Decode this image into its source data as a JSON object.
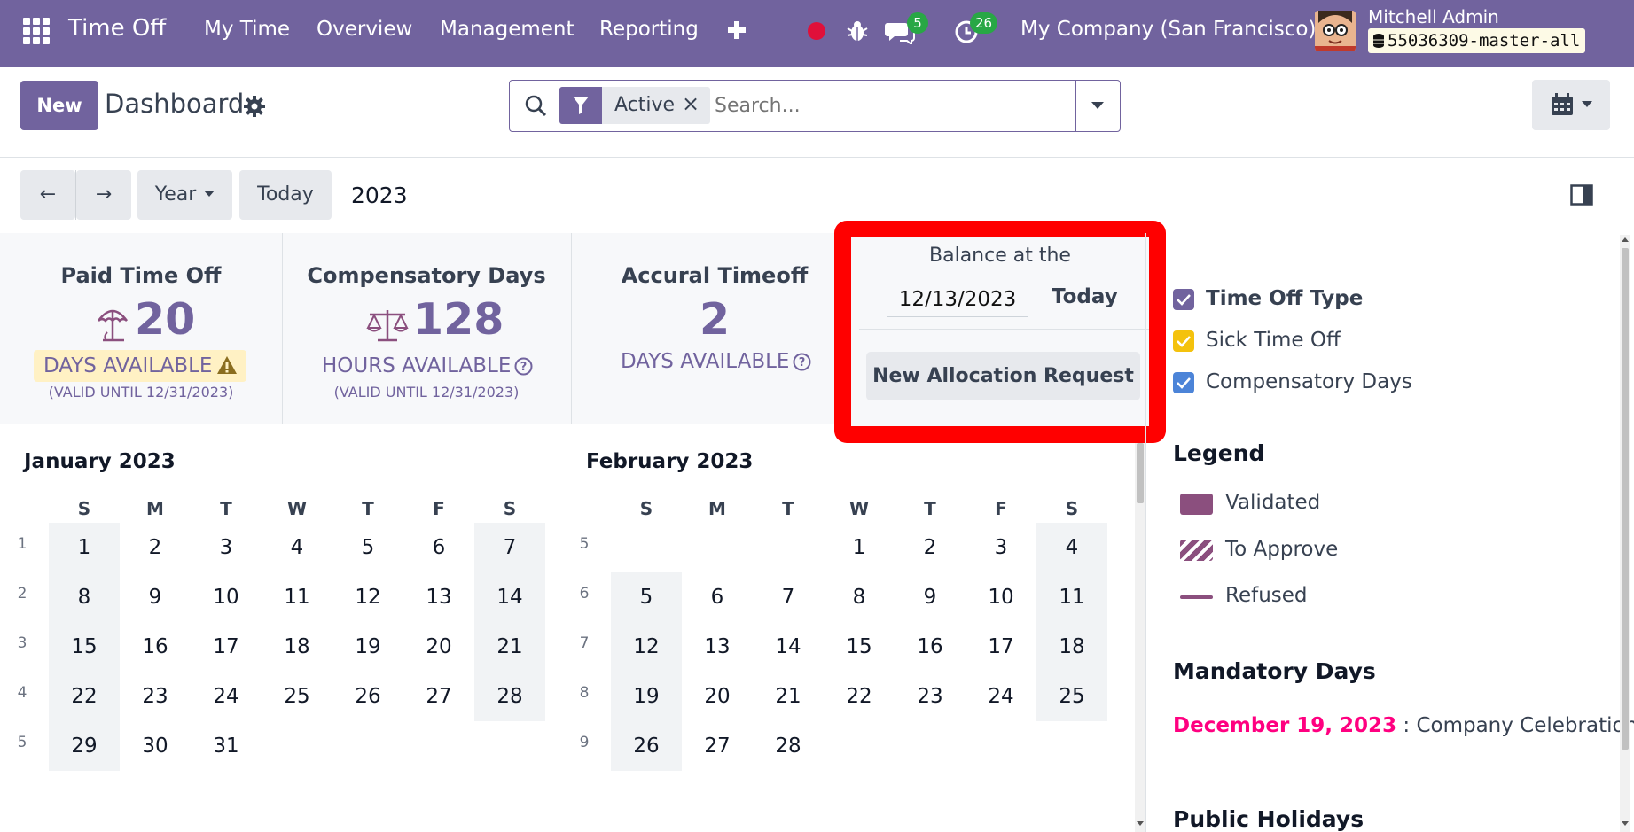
{
  "navbar": {
    "app_name": "Time Off",
    "menu": [
      "My Time",
      "Overview",
      "Management",
      "Reporting"
    ],
    "messages_count": "5",
    "activities_count": "26",
    "company": "My Company (San Francisco)",
    "user_name": "Mitchell Admin",
    "database": "55036309-master-all"
  },
  "control": {
    "new_label": "New",
    "title": "Dashboard",
    "facet": "Active",
    "facet_remove": "×",
    "search_placeholder": "Search..."
  },
  "nav": {
    "prev": "←",
    "next": "→",
    "scale": "Year",
    "today": "Today",
    "period": "2023"
  },
  "summary": [
    {
      "title": "Paid Time Off",
      "value": "20",
      "label": "DAYS AVAILABLE",
      "valid": "(VALID UNTIL 12/31/2023)"
    },
    {
      "title": "Compensatory Days",
      "value": "128",
      "label": "HOURS AVAILABLE",
      "valid": "(VALID UNTIL 12/31/2023)"
    },
    {
      "title": "Accural Timeoff",
      "value": "2",
      "label": "DAYS AVAILABLE"
    }
  ],
  "balance": {
    "title": "Balance at the",
    "date": "12/13/2023",
    "today": "Today",
    "new_allocation": "New Allocation Request"
  },
  "weekdays": [
    "S",
    "M",
    "T",
    "W",
    "T",
    "F",
    "S"
  ],
  "months": [
    {
      "title": "January 2023",
      "weeks": [
        {
          "num": "1",
          "days": [
            "1",
            "2",
            "3",
            "4",
            "5",
            "6",
            "7"
          ]
        },
        {
          "num": "2",
          "days": [
            "8",
            "9",
            "10",
            "11",
            "12",
            "13",
            "14"
          ]
        },
        {
          "num": "3",
          "days": [
            "15",
            "16",
            "17",
            "18",
            "19",
            "20",
            "21"
          ]
        },
        {
          "num": "4",
          "days": [
            "22",
            "23",
            "24",
            "25",
            "26",
            "27",
            "28"
          ]
        },
        {
          "num": "5",
          "days": [
            "29",
            "30",
            "31",
            "",
            "",
            "",
            ""
          ]
        }
      ]
    },
    {
      "title": "February 2023",
      "weeks": [
        {
          "num": "5",
          "days": [
            "",
            "",
            "",
            "1",
            "2",
            "3",
            "4"
          ]
        },
        {
          "num": "6",
          "days": [
            "5",
            "6",
            "7",
            "8",
            "9",
            "10",
            "11"
          ]
        },
        {
          "num": "7",
          "days": [
            "12",
            "13",
            "14",
            "15",
            "16",
            "17",
            "18"
          ]
        },
        {
          "num": "8",
          "days": [
            "19",
            "20",
            "21",
            "22",
            "23",
            "24",
            "25"
          ]
        },
        {
          "num": "9",
          "days": [
            "26",
            "27",
            "28",
            "",
            "",
            "",
            ""
          ]
        }
      ]
    }
  ],
  "filters": {
    "heading": "Time Off Type",
    "items": [
      {
        "label": "Sick Time Off",
        "color": "#f4c20d"
      },
      {
        "label": "Compensatory Days",
        "color": "#4c84d8"
      }
    ],
    "heading_color": "#71639e"
  },
  "legend": {
    "title": "Legend",
    "validated": "Validated",
    "to_approve": "To Approve",
    "refused": "Refused",
    "color": "#8b4f7e"
  },
  "mandatory": {
    "title": "Mandatory Days",
    "date": "December 19, 2023",
    "separator": " : ",
    "name": "Company Celebration",
    "date_color": "#ff0080"
  },
  "public_holidays": {
    "title": "Public Holidays"
  },
  "colors": {
    "brand": "#71639e",
    "highlight": "#ff0000"
  }
}
